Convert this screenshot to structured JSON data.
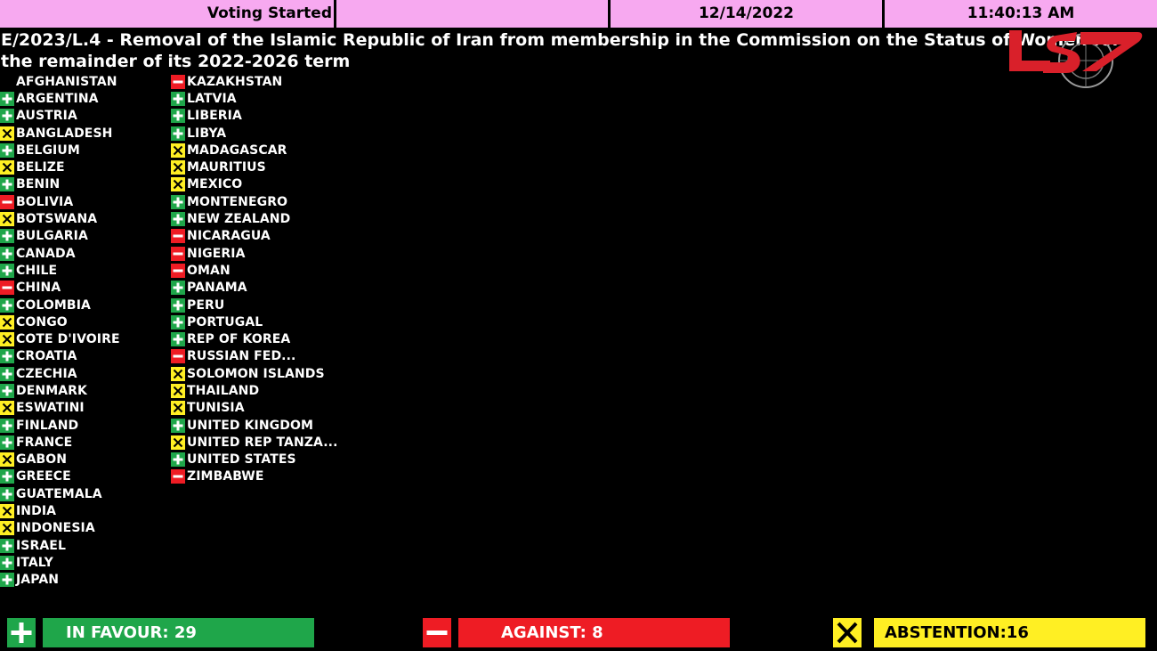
{
  "header": {
    "status": "Voting Started",
    "blank": "",
    "date": "12/14/2022",
    "time": "11:40:13 AM"
  },
  "resolution": {
    "title": "E/2023/L.4 - Removal of the Islamic Republic of Iran from membership in the Commission on the Status of Women for the remainder of its 2022-2026 term"
  },
  "logo": {
    "icon": "channel-logo-with-un-emblem",
    "color": "#d9202a"
  },
  "colors": {
    "favour": "#1fa64a",
    "against": "#ee1c24",
    "abstention": "#ffef23",
    "header": "#f7a9f0"
  },
  "columns": [
    [
      {
        "name": "AFGHANISTAN",
        "vote": "none"
      },
      {
        "name": "ARGENTINA",
        "vote": "yes"
      },
      {
        "name": "AUSTRIA",
        "vote": "yes"
      },
      {
        "name": "BANGLADESH",
        "vote": "abstain"
      },
      {
        "name": "BELGIUM",
        "vote": "yes"
      },
      {
        "name": "BELIZE",
        "vote": "abstain"
      },
      {
        "name": "BENIN",
        "vote": "yes"
      },
      {
        "name": "BOLIVIA",
        "vote": "no"
      },
      {
        "name": "BOTSWANA",
        "vote": "abstain"
      },
      {
        "name": "BULGARIA",
        "vote": "yes"
      },
      {
        "name": "CANADA",
        "vote": "yes"
      },
      {
        "name": "CHILE",
        "vote": "yes"
      },
      {
        "name": "CHINA",
        "vote": "no"
      },
      {
        "name": "COLOMBIA",
        "vote": "yes"
      },
      {
        "name": "CONGO",
        "vote": "abstain"
      },
      {
        "name": "COTE D'IVOIRE",
        "vote": "abstain"
      },
      {
        "name": "CROATIA",
        "vote": "yes"
      },
      {
        "name": "CZECHIA",
        "vote": "yes"
      },
      {
        "name": "DENMARK",
        "vote": "yes"
      },
      {
        "name": "ESWATINI",
        "vote": "abstain"
      },
      {
        "name": "FINLAND",
        "vote": "yes"
      },
      {
        "name": "FRANCE",
        "vote": "yes"
      },
      {
        "name": "GABON",
        "vote": "abstain"
      },
      {
        "name": "GREECE",
        "vote": "yes"
      },
      {
        "name": "GUATEMALA",
        "vote": "yes"
      },
      {
        "name": "INDIA",
        "vote": "abstain"
      },
      {
        "name": "INDONESIA",
        "vote": "abstain"
      },
      {
        "name": "ISRAEL",
        "vote": "yes"
      },
      {
        "name": "ITALY",
        "vote": "yes"
      },
      {
        "name": "JAPAN",
        "vote": "yes"
      }
    ],
    [
      {
        "name": "KAZAKHSTAN",
        "vote": "no"
      },
      {
        "name": "LATVIA",
        "vote": "yes"
      },
      {
        "name": "LIBERIA",
        "vote": "yes"
      },
      {
        "name": "LIBYA",
        "vote": "yes"
      },
      {
        "name": "MADAGASCAR",
        "vote": "abstain"
      },
      {
        "name": "MAURITIUS",
        "vote": "abstain"
      },
      {
        "name": "MEXICO",
        "vote": "abstain"
      },
      {
        "name": "MONTENEGRO",
        "vote": "yes"
      },
      {
        "name": "NEW ZEALAND",
        "vote": "yes"
      },
      {
        "name": "NICARAGUA",
        "vote": "no"
      },
      {
        "name": "NIGERIA",
        "vote": "no"
      },
      {
        "name": "OMAN",
        "vote": "no"
      },
      {
        "name": "PANAMA",
        "vote": "yes"
      },
      {
        "name": "PERU",
        "vote": "yes"
      },
      {
        "name": "PORTUGAL",
        "vote": "yes"
      },
      {
        "name": "REP OF KOREA",
        "vote": "yes"
      },
      {
        "name": "RUSSIAN FED...",
        "vote": "no"
      },
      {
        "name": "SOLOMON ISLANDS",
        "vote": "abstain"
      },
      {
        "name": "THAILAND",
        "vote": "abstain"
      },
      {
        "name": "TUNISIA",
        "vote": "abstain"
      },
      {
        "name": "UNITED KINGDOM",
        "vote": "yes"
      },
      {
        "name": "UNITED REP TANZA...",
        "vote": "abstain"
      },
      {
        "name": "UNITED STATES",
        "vote": "yes"
      },
      {
        "name": "ZIMBABWE",
        "vote": "no"
      }
    ]
  ],
  "totals": {
    "favour": "IN FAVOUR: 29",
    "against": "AGAINST: 8",
    "abstention": "ABSTENTION:16"
  }
}
